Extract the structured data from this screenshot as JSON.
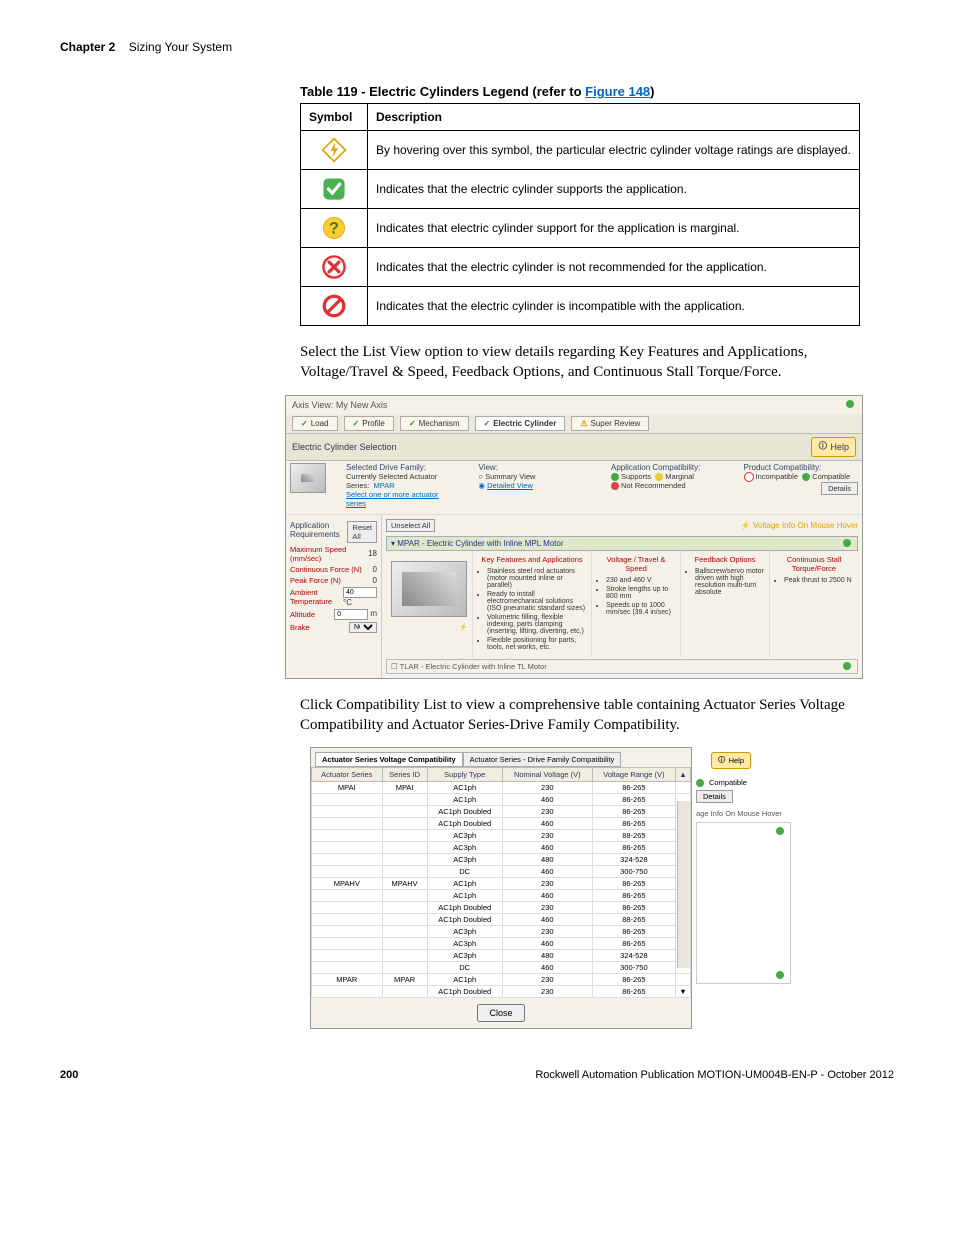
{
  "header": {
    "chapter_label": "Chapter 2",
    "chapter_title": "Sizing Your System"
  },
  "table_title_prefix": "Table 119 - Electric Cylinders Legend (refer to ",
  "table_title_link": "Figure 148",
  "table_title_suffix": ")",
  "legend": {
    "col_symbol": "Symbol",
    "col_desc": "Description",
    "rows": [
      {
        "desc": "By hovering over this symbol, the particular electric cylinder voltage ratings are displayed."
      },
      {
        "desc": "Indicates that the electric cylinder supports the application."
      },
      {
        "desc": "Indicates that electric cylinder support for the application is marginal."
      },
      {
        "desc": "Indicates that the electric cylinder is not recommended for the application."
      },
      {
        "desc": "Indicates that the electric cylinder is incompatible with the application."
      }
    ]
  },
  "para1": "Select the List View option to view details regarding Key Features and Applications, Voltage/Travel & Speed, Feedback Options, and Continuous Stall Torque/Force.",
  "para2": "Click Compatibility List to view a comprehensive table containing Actuator Series Voltage Compatibility and Actuator Series-Drive Family Compatibility.",
  "shot1": {
    "axis_view": "Axis View: My New Axis",
    "tabs": [
      "Load",
      "Profile",
      "Mechanism",
      "Electric Cylinder",
      "Super Review"
    ],
    "section": "Electric Cylinder Selection",
    "help": "Help",
    "drive_family_label": "Selected Drive Family:",
    "actuator_label": "Currently Selected Actuator Series:",
    "actuator_value": "MPAR",
    "actuator_hint": "Select one or more actuator series",
    "view_label": "View:",
    "view_summary": "Summary View",
    "view_detailed": "Detailed View",
    "appcompat_label": "Application Compatibility:",
    "supports": "Supports",
    "marginal": "Marginal",
    "notrec": "Not Recommended",
    "prodcompat_label": "Product Compatibility:",
    "incompat": "Incompatible",
    "compat": "Compatible",
    "details": "Details",
    "app_req": "Application Requirements",
    "reset": "Reset All",
    "unselect": "Unselect All",
    "voltage_hover": "Voltage Info On Mouse Hover",
    "params": [
      {
        "label": "Maximum Speed (mm/sec)",
        "val": "18"
      },
      {
        "label": "Continuous Force   (N)",
        "val": "0"
      },
      {
        "label": "Peak Force   (N)",
        "val": "0"
      },
      {
        "label": "Ambient Temperature",
        "val": "40",
        "unit": "°C"
      },
      {
        "label": "Altitude",
        "val": "0",
        "unit": "m"
      },
      {
        "label": "Brake",
        "val": "NO"
      }
    ],
    "card_title": "MPAR - Electric Cylinder with Inline MPL Motor",
    "card_cols": {
      "features": "Key Features and Applications",
      "voltage": "Voltage / Travel & Speed",
      "feedback": "Feedback Options",
      "torque": "Continuous Stall Torque/Force"
    },
    "features_items": [
      "Stainless steel rod actuators (motor mounted inline or parallel)",
      "Ready to install electromechanical solutions (ISO pneumatic standard sizes)",
      "Volumetric filling, flexible indexing, parts clamping (inserting, lifting, diverting, etc.)",
      "Flexible positioning for parts, tools, net works, etc."
    ],
    "voltage_items": [
      "230 and 460 V",
      "Stroke lengths up to 800 mm",
      "Speeds up to 1000 mm/sec (39.4 in/sec)"
    ],
    "feedback_items": [
      "Ballscrew/servo motor driven with high resolution multi-turn absolute"
    ],
    "torque_items": [
      "Peak thrust to 2500 N"
    ],
    "row2": "TLAR - Electric Cylinder with Inline TL Motor"
  },
  "shot2": {
    "help": "Help",
    "compat": "Compatible",
    "details": "Details",
    "voltage_hover": "age Info On Mouse Hover",
    "tab1": "Actuator Series Voltage Compatibility",
    "tab2": "Actuator Series - Drive Family Compatibility",
    "headers": [
      "Actuator Series",
      "Series ID",
      "Supply Type",
      "Nominal Voltage (V)",
      "Voltage Range (V)"
    ],
    "rows": [
      [
        "MPAI",
        "MPAI",
        "AC1ph",
        "230",
        "86-265"
      ],
      [
        "",
        "",
        "AC1ph",
        "460",
        "86-265"
      ],
      [
        "",
        "",
        "AC1ph Doubled",
        "230",
        "86-265"
      ],
      [
        "",
        "",
        "AC1ph Doubled",
        "460",
        "86-265"
      ],
      [
        "",
        "",
        "AC3ph",
        "230",
        "88-265"
      ],
      [
        "",
        "",
        "AC3ph",
        "460",
        "86-265"
      ],
      [
        "",
        "",
        "AC3ph",
        "480",
        "324-528"
      ],
      [
        "",
        "",
        "DC",
        "460",
        "300-750"
      ],
      [
        "MPAHV",
        "MPAHV",
        "AC1ph",
        "230",
        "86-265"
      ],
      [
        "",
        "",
        "AC1ph",
        "460",
        "86-265"
      ],
      [
        "",
        "",
        "AC1ph Doubled",
        "230",
        "86-265"
      ],
      [
        "",
        "",
        "AC1ph Doubled",
        "460",
        "88-265"
      ],
      [
        "",
        "",
        "AC3ph",
        "230",
        "86-265"
      ],
      [
        "",
        "",
        "AC3ph",
        "460",
        "86-265"
      ],
      [
        "",
        "",
        "AC3ph",
        "480",
        "324-528"
      ],
      [
        "",
        "",
        "DC",
        "460",
        "300-750"
      ],
      [
        "MPAR",
        "MPAR",
        "AC1ph",
        "230",
        "86-265"
      ],
      [
        "",
        "",
        "AC1ph Doubled",
        "230",
        "86-265"
      ]
    ],
    "close": "Close"
  },
  "footer": {
    "page": "200",
    "pub": "Rockwell Automation Publication MOTION-UM004B-EN-P - October 2012"
  }
}
